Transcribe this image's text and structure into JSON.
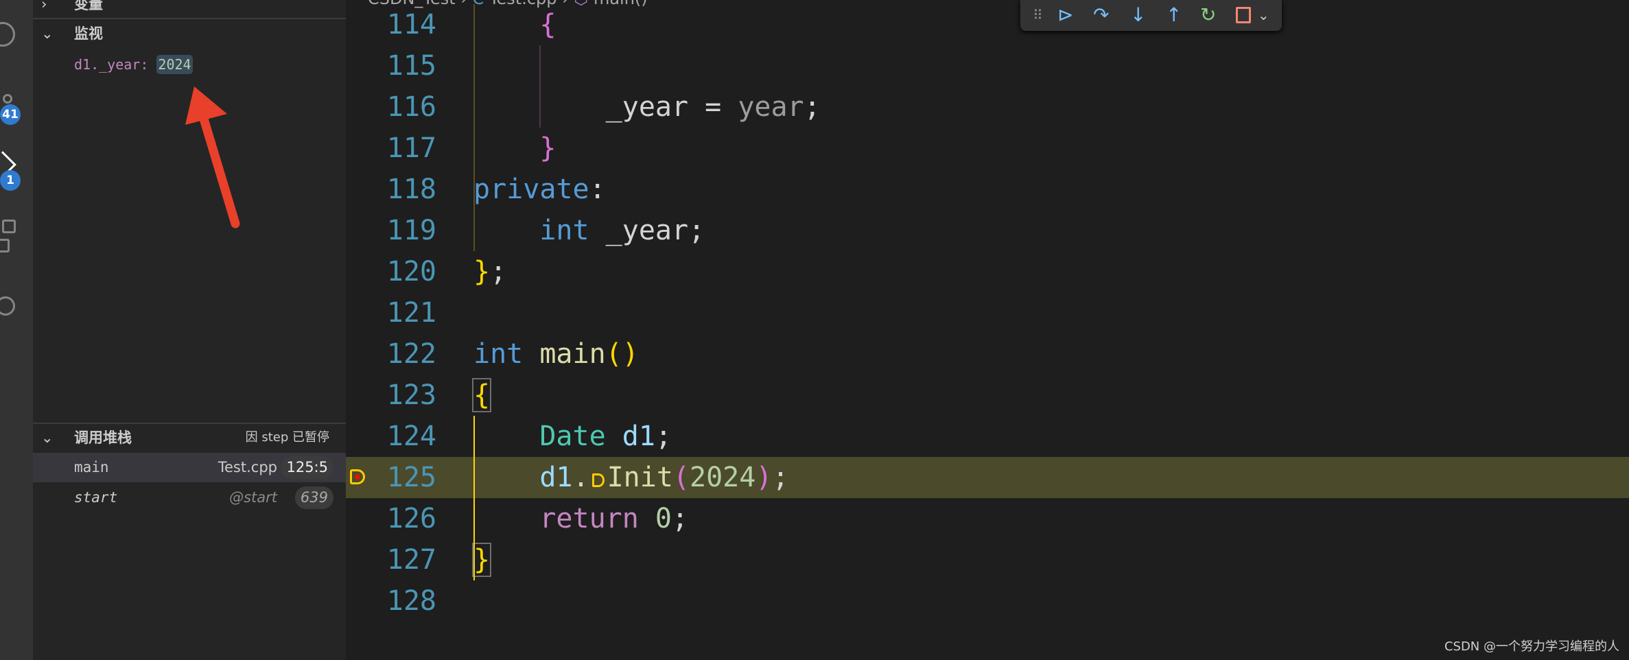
{
  "activity_bar": {
    "scm_badge": "41",
    "debug_badge": "1"
  },
  "sidebar": {
    "variables_header": "变量",
    "watch_header": "监视",
    "watch_items": [
      {
        "expr": "d1._year:",
        "value": "2024"
      }
    ],
    "callstack_header": "调用堆栈",
    "callstack_status": "因 step 已暂停",
    "frames": [
      {
        "name": "main",
        "source": "Test.cpp",
        "pos": "125:5"
      },
      {
        "name": "start",
        "source": "@start",
        "pos": "639"
      }
    ]
  },
  "breadcrumb": {
    "folder": "CSDN_Test",
    "file": "Test.cpp",
    "symbol": "main()"
  },
  "debug_toolbar": {
    "icons": [
      "drag-handle-icon",
      "continue-icon",
      "step-over-icon",
      "step-into-icon",
      "step-out-icon",
      "restart-icon",
      "stop-icon",
      "chevron-down-icon"
    ]
  },
  "editor": {
    "current_line": "125",
    "lines": [
      {
        "num": "114",
        "tokens": [
          {
            "t": "    {",
            "c": "pink"
          }
        ]
      },
      {
        "num": "115",
        "tokens": []
      },
      {
        "num": "116",
        "tokens": [
          {
            "t": "        _year = ",
            "c": "w"
          },
          {
            "t": "year",
            "c": "g"
          },
          {
            "t": ";",
            "c": "w"
          }
        ]
      },
      {
        "num": "117",
        "tokens": [
          {
            "t": "    }",
            "c": "pink"
          }
        ]
      },
      {
        "num": "118",
        "tokens": [
          {
            "t": "private",
            "c": "b"
          },
          {
            "t": ":",
            "c": "w"
          }
        ]
      },
      {
        "num": "119",
        "tokens": [
          {
            "t": "    int",
            "c": "b"
          },
          {
            "t": " _year;",
            "c": "w"
          }
        ]
      },
      {
        "num": "120",
        "tokens": [
          {
            "t": "}",
            "c": "gold"
          },
          {
            "t": ";",
            "c": "w"
          }
        ]
      },
      {
        "num": "121",
        "tokens": []
      },
      {
        "num": "122",
        "tokens": [
          {
            "t": "int",
            "c": "b"
          },
          {
            "t": " main",
            "c": "y"
          },
          {
            "t": "()",
            "c": "gold"
          }
        ]
      },
      {
        "num": "123",
        "tokens": [
          {
            "t": "{",
            "c": "gold",
            "box": true
          }
        ]
      },
      {
        "num": "124",
        "tokens": [
          {
            "t": "    Date",
            "c": "t"
          },
          {
            "t": " d1",
            "c": "lb"
          },
          {
            "t": ";",
            "c": "w"
          }
        ]
      },
      {
        "num": "125",
        "tokens": [
          {
            "t": "    d1",
            "c": "lb"
          },
          {
            "t": ".",
            "c": "w"
          },
          {
            "t": "Init",
            "c": "y",
            "bp": true
          },
          {
            "t": "(",
            "c": "pink"
          },
          {
            "t": "2024",
            "c": "n"
          },
          {
            "t": ")",
            "c": "pink"
          },
          {
            "t": ";",
            "c": "w"
          }
        ]
      },
      {
        "num": "126",
        "tokens": [
          {
            "t": "    return",
            "c": "p"
          },
          {
            "t": " 0",
            "c": "n"
          },
          {
            "t": ";",
            "c": "w"
          }
        ]
      },
      {
        "num": "127",
        "tokens": [
          {
            "t": "}",
            "c": "gold",
            "box": true
          }
        ]
      },
      {
        "num": "128",
        "tokens": []
      }
    ]
  },
  "colors": {
    "accent": "#2f7bd0",
    "current_line": "#4b4a2b",
    "arrow": "#e8402a"
  },
  "watermark": "CSDN @一个努力学习编程的人"
}
